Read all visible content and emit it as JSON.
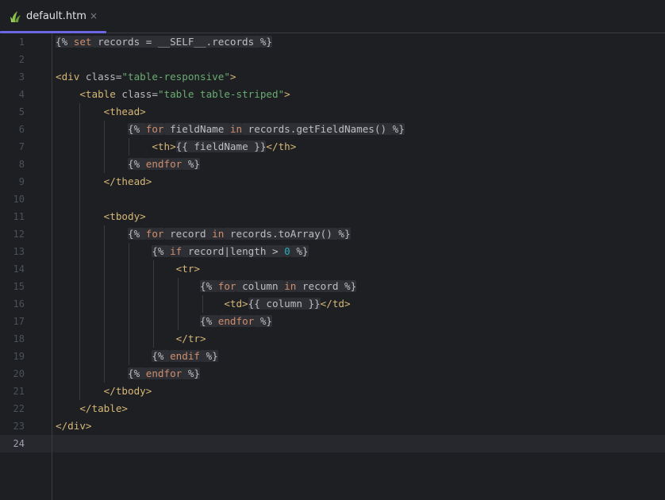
{
  "tab": {
    "filename": "default.htm",
    "close_glyph": "×",
    "icon": "twig-leaf-icon",
    "underline_color": "#6b67e2"
  },
  "editor": {
    "current_line": 24,
    "line_numbers": [
      "1",
      "2",
      "3",
      "4",
      "5",
      "6",
      "7",
      "8",
      "9",
      "10",
      "11",
      "12",
      "13",
      "14",
      "15",
      "16",
      "17",
      "18",
      "19",
      "20",
      "21",
      "22",
      "23",
      "24"
    ],
    "lines": [
      [
        {
          "t": "{% ",
          "c": "delim",
          "bg": 1
        },
        {
          "t": "set",
          "c": "kw",
          "bg": 1
        },
        {
          "t": " records = __SELF__.records ",
          "c": "plain",
          "bg": 1
        },
        {
          "t": "%}",
          "c": "delim",
          "bg": 1
        }
      ],
      [],
      [
        {
          "t": "<div ",
          "c": "tag"
        },
        {
          "t": "class",
          "c": "attr"
        },
        {
          "t": "=",
          "c": "plain"
        },
        {
          "t": "\"table-responsive\"",
          "c": "str"
        },
        {
          "t": ">",
          "c": "tag"
        }
      ],
      [
        {
          "t": "    "
        },
        {
          "t": "<table ",
          "c": "tag"
        },
        {
          "t": "class",
          "c": "attr"
        },
        {
          "t": "=",
          "c": "plain"
        },
        {
          "t": "\"table table-striped\"",
          "c": "str"
        },
        {
          "t": ">",
          "c": "tag"
        }
      ],
      [
        {
          "t": "        "
        },
        {
          "t": "<thead>",
          "c": "tag"
        }
      ],
      [
        {
          "t": "            "
        },
        {
          "t": "{% ",
          "c": "delim",
          "bg": 1
        },
        {
          "t": "for",
          "c": "kw",
          "bg": 1
        },
        {
          "t": " fieldName ",
          "c": "plain",
          "bg": 1
        },
        {
          "t": "in",
          "c": "kw",
          "bg": 1
        },
        {
          "t": " records.getFieldNames() ",
          "c": "plain",
          "bg": 1
        },
        {
          "t": "%}",
          "c": "delim",
          "bg": 1
        }
      ],
      [
        {
          "t": "                "
        },
        {
          "t": "<th>",
          "c": "tag"
        },
        {
          "t": "{{ fieldName }}",
          "c": "plain",
          "bg": 1
        },
        {
          "t": "</th>",
          "c": "tag"
        }
      ],
      [
        {
          "t": "            "
        },
        {
          "t": "{% ",
          "c": "delim",
          "bg": 1
        },
        {
          "t": "endfor",
          "c": "kw",
          "bg": 1
        },
        {
          "t": " %}",
          "c": "delim",
          "bg": 1
        }
      ],
      [
        {
          "t": "        "
        },
        {
          "t": "</thead>",
          "c": "tag"
        }
      ],
      [],
      [
        {
          "t": "        "
        },
        {
          "t": "<tbody>",
          "c": "tag"
        }
      ],
      [
        {
          "t": "            "
        },
        {
          "t": "{% ",
          "c": "delim",
          "bg": 1
        },
        {
          "t": "for",
          "c": "kw",
          "bg": 1
        },
        {
          "t": " record ",
          "c": "plain",
          "bg": 1
        },
        {
          "t": "in",
          "c": "kw",
          "bg": 1
        },
        {
          "t": " records.toArray() ",
          "c": "plain",
          "bg": 1
        },
        {
          "t": "%}",
          "c": "delim",
          "bg": 1
        }
      ],
      [
        {
          "t": "                "
        },
        {
          "t": "{% ",
          "c": "delim",
          "bg": 1
        },
        {
          "t": "if",
          "c": "kw",
          "bg": 1
        },
        {
          "t": " record|length > ",
          "c": "plain",
          "bg": 1
        },
        {
          "t": "0",
          "c": "num",
          "bg": 1
        },
        {
          "t": " %}",
          "c": "delim",
          "bg": 1
        }
      ],
      [
        {
          "t": "                    "
        },
        {
          "t": "<tr>",
          "c": "tag"
        }
      ],
      [
        {
          "t": "                        "
        },
        {
          "t": "{% ",
          "c": "delim",
          "bg": 1
        },
        {
          "t": "for",
          "c": "kw",
          "bg": 1
        },
        {
          "t": " column ",
          "c": "plain",
          "bg": 1
        },
        {
          "t": "in",
          "c": "kw",
          "bg": 1
        },
        {
          "t": " record ",
          "c": "plain",
          "bg": 1
        },
        {
          "t": "%}",
          "c": "delim",
          "bg": 1
        }
      ],
      [
        {
          "t": "                            "
        },
        {
          "t": "<td>",
          "c": "tag"
        },
        {
          "t": "{{ column }}",
          "c": "plain",
          "bg": 1
        },
        {
          "t": "</td>",
          "c": "tag"
        }
      ],
      [
        {
          "t": "                        "
        },
        {
          "t": "{% ",
          "c": "delim",
          "bg": 1
        },
        {
          "t": "endfor",
          "c": "kw",
          "bg": 1
        },
        {
          "t": " %}",
          "c": "delim",
          "bg": 1
        }
      ],
      [
        {
          "t": "                    "
        },
        {
          "t": "</tr>",
          "c": "tag"
        }
      ],
      [
        {
          "t": "                "
        },
        {
          "t": "{% ",
          "c": "delim",
          "bg": 1
        },
        {
          "t": "endif",
          "c": "kw",
          "bg": 1
        },
        {
          "t": " %}",
          "c": "delim",
          "bg": 1
        }
      ],
      [
        {
          "t": "            "
        },
        {
          "t": "{% ",
          "c": "delim",
          "bg": 1
        },
        {
          "t": "endfor",
          "c": "kw",
          "bg": 1
        },
        {
          "t": " %}",
          "c": "delim",
          "bg": 1
        }
      ],
      [
        {
          "t": "        "
        },
        {
          "t": "</tbody>",
          "c": "tag"
        }
      ],
      [
        {
          "t": "    "
        },
        {
          "t": "</table>",
          "c": "tag"
        }
      ],
      [
        {
          "t": "</div>",
          "c": "tag"
        }
      ],
      []
    ]
  }
}
